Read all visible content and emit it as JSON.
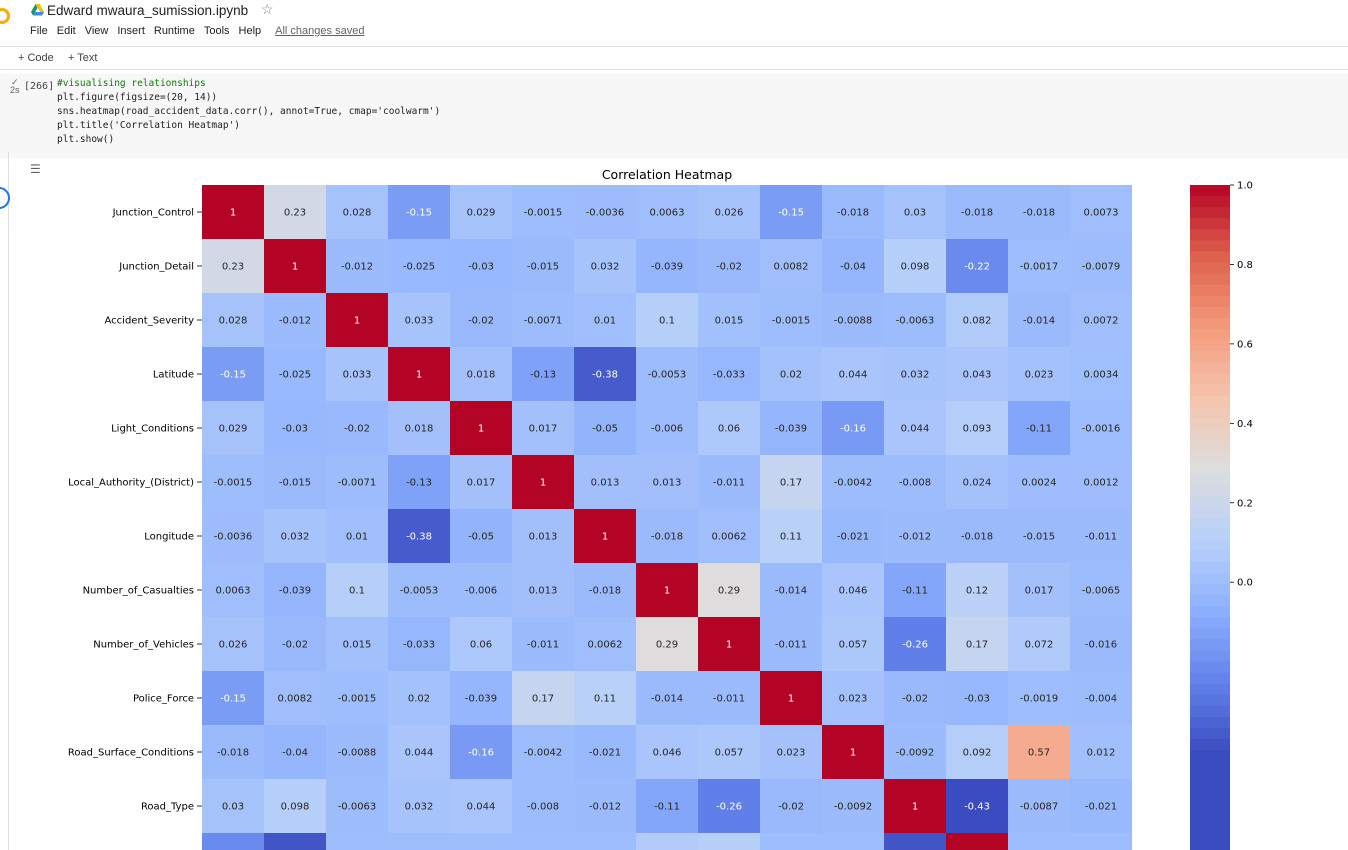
{
  "header": {
    "title": "Edward mwaura_sumission.ipynb",
    "star": "☆",
    "menu": [
      "File",
      "Edit",
      "View",
      "Insert",
      "Runtime",
      "Tools",
      "Help"
    ],
    "saved_status": "All changes saved"
  },
  "toolbar": {
    "code_label": "+ Code",
    "text_label": "+ Text"
  },
  "cell": {
    "exec_count": "[266]",
    "run_time": "2s",
    "code_lines": [
      "#visualising relationships",
      "plt.figure(figsize=(20, 14))",
      "sns.heatmap(road_accident_data.corr(), annot=True, cmap='coolwarm')",
      "plt.title('Correlation Heatmap')",
      "plt.show()"
    ]
  },
  "chart_data": {
    "type": "heatmap",
    "title": "Correlation Heatmap",
    "colormap": "coolwarm",
    "vmin": -0.43,
    "vmax": 1.0,
    "colorbar_ticks": [
      "1.0",
      "0.8",
      "0.6",
      "0.4",
      "0.2",
      "0.0"
    ],
    "row_labels": [
      "Junction_Control",
      "Junction_Detail",
      "Accident_Severity",
      "Latitude",
      "Light_Conditions",
      "Local_Authority_(District)",
      "Longitude",
      "Number_of_Casualties",
      "Number_of_Vehicles",
      "Police_Force",
      "Road_Surface_Conditions",
      "Road_Type"
    ],
    "values": [
      [
        "1",
        "0.23",
        "0.028",
        "-0.15",
        "0.029",
        "-0.0015",
        "-0.0036",
        "0.0063",
        "0.026",
        "-0.15",
        "-0.018",
        "0.03",
        "-0.018",
        "-0.018",
        "0.0073"
      ],
      [
        "0.23",
        "1",
        "-0.012",
        "-0.025",
        "-0.03",
        "-0.015",
        "0.032",
        "-0.039",
        "-0.02",
        "0.0082",
        "-0.04",
        "0.098",
        "-0.22",
        "-0.0017",
        "-0.0079"
      ],
      [
        "0.028",
        "-0.012",
        "1",
        "0.033",
        "-0.02",
        "-0.0071",
        "0.01",
        "0.1",
        "0.015",
        "-0.0015",
        "-0.0088",
        "-0.0063",
        "0.082",
        "-0.014",
        "0.0072"
      ],
      [
        "-0.15",
        "-0.025",
        "0.033",
        "1",
        "0.018",
        "-0.13",
        "-0.38",
        "-0.0053",
        "-0.033",
        "0.02",
        "0.044",
        "0.032",
        "0.043",
        "0.023",
        "0.0034"
      ],
      [
        "0.029",
        "-0.03",
        "-0.02",
        "0.018",
        "1",
        "0.017",
        "-0.05",
        "-0.006",
        "0.06",
        "-0.039",
        "-0.16",
        "0.044",
        "0.093",
        "-0.11",
        "-0.0016"
      ],
      [
        "-0.0015",
        "-0.015",
        "-0.0071",
        "-0.13",
        "0.017",
        "1",
        "0.013",
        "0.013",
        "-0.011",
        "0.17",
        "-0.0042",
        "-0.008",
        "0.024",
        "0.0024",
        "0.0012"
      ],
      [
        "-0.0036",
        "0.032",
        "0.01",
        "-0.38",
        "-0.05",
        "0.013",
        "1",
        "-0.018",
        "0.0062",
        "0.11",
        "-0.021",
        "-0.012",
        "-0.018",
        "-0.015",
        "-0.011"
      ],
      [
        "0.0063",
        "-0.039",
        "0.1",
        "-0.0053",
        "-0.006",
        "0.013",
        "-0.018",
        "1",
        "0.29",
        "-0.014",
        "0.046",
        "-0.11",
        "0.12",
        "0.017",
        "-0.0065"
      ],
      [
        "0.026",
        "-0.02",
        "0.015",
        "-0.033",
        "0.06",
        "-0.011",
        "0.0062",
        "0.29",
        "1",
        "-0.011",
        "0.057",
        "-0.26",
        "0.17",
        "0.072",
        "-0.016"
      ],
      [
        "-0.15",
        "0.0082",
        "-0.0015",
        "0.02",
        "-0.039",
        "0.17",
        "0.11",
        "-0.014",
        "-0.011",
        "1",
        "0.023",
        "-0.02",
        "-0.03",
        "-0.0019",
        "-0.004"
      ],
      [
        "-0.018",
        "-0.04",
        "-0.0088",
        "0.044",
        "-0.16",
        "-0.0042",
        "-0.021",
        "0.046",
        "0.057",
        "0.023",
        "1",
        "-0.0092",
        "0.092",
        "0.57",
        "0.012"
      ],
      [
        "0.03",
        "0.098",
        "-0.0063",
        "0.032",
        "0.044",
        "-0.008",
        "-0.012",
        "-0.11",
        "-0.26",
        "-0.02",
        "-0.0092",
        "1",
        "-0.43",
        "-0.0087",
        "-0.021"
      ]
    ],
    "partial_row_values": [
      -0.22,
      -0.4,
      0.0,
      0.0,
      0.0,
      0.0,
      0.0,
      0.08,
      0.1,
      0.0,
      0.0,
      -0.4,
      1,
      0.0,
      0.0
    ]
  }
}
